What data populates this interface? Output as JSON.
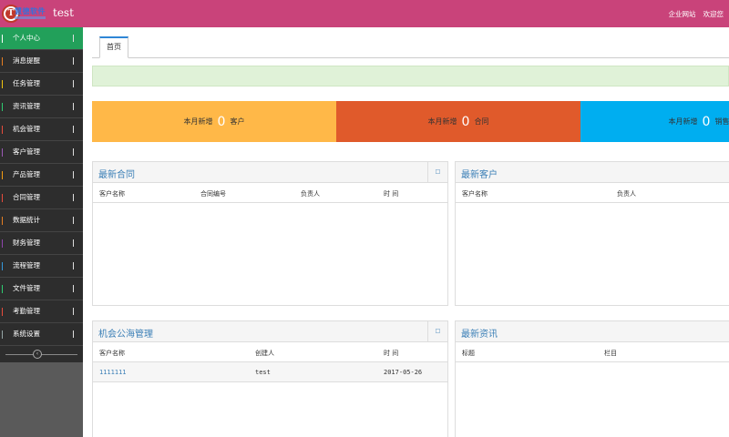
{
  "header": {
    "brand": "慧德软件",
    "title": "test",
    "links": [
      "企业网站",
      "欢迎您"
    ],
    "color": "#c9437a"
  },
  "sidebar": {
    "items": [
      {
        "label": "个人中心",
        "active": true,
        "bar_color": "#ffffff"
      },
      {
        "label": "消息提醒",
        "active": false,
        "bar_color": "#e67e22"
      },
      {
        "label": "任务管理",
        "active": false,
        "bar_color": "#f1c40f"
      },
      {
        "label": "资讯管理",
        "active": false,
        "bar_color": "#2ecc71"
      },
      {
        "label": "机会管理",
        "active": false,
        "bar_color": "#e74c3c"
      },
      {
        "label": "客户管理",
        "active": false,
        "bar_color": "#9b59b6"
      },
      {
        "label": "产品管理",
        "active": false,
        "bar_color": "#f39c12"
      },
      {
        "label": "合同管理",
        "active": false,
        "bar_color": "#e74c3c"
      },
      {
        "label": "数据统计",
        "active": false,
        "bar_color": "#e67e22"
      },
      {
        "label": "财务管理",
        "active": false,
        "bar_color": "#8e44ad"
      },
      {
        "label": "流程管理",
        "active": false,
        "bar_color": "#3498db"
      },
      {
        "label": "文件管理",
        "active": false,
        "bar_color": "#2ecc71"
      },
      {
        "label": "考勤管理",
        "active": false,
        "bar_color": "#e74c3c"
      },
      {
        "label": "系统设置",
        "active": false,
        "bar_color": "#95a5a6"
      }
    ],
    "collapse_icon": "collapse-icon"
  },
  "tabs": [
    {
      "label": "首页"
    }
  ],
  "stats": [
    {
      "prefix": "本月新增",
      "value": "0",
      "suffix": "客户",
      "color": "#ffb848"
    },
    {
      "prefix": "本月新增",
      "value": "0",
      "suffix": "合同",
      "color": "#e05a2b"
    },
    {
      "prefix": "本月新增",
      "value": "0",
      "suffix": "销售机",
      "color": "#00aef0"
    }
  ],
  "panels": {
    "contracts": {
      "title": "最新合同",
      "columns": [
        "客户名称",
        "合同编号",
        "负责人",
        "时  间"
      ],
      "rows": []
    },
    "customers": {
      "title": "最新客户",
      "columns": [
        "客户名称",
        "负责人"
      ],
      "rows": []
    },
    "opportunities": {
      "title": "机会公海管理",
      "columns": [
        "客户名称",
        "创建人",
        "时  间"
      ],
      "rows": [
        [
          "1111111",
          "test",
          "2017-05-26"
        ]
      ]
    },
    "news": {
      "title": "最新资讯",
      "columns": [
        "标题",
        "栏目"
      ],
      "rows": []
    }
  }
}
